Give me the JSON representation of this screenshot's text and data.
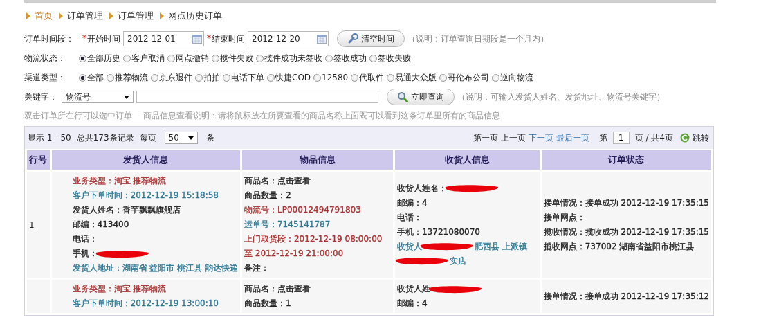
{
  "breadcrumb": [
    {
      "text": "首页",
      "home": true
    },
    {
      "text": "订单管理",
      "home": false
    },
    {
      "text": "订单管理",
      "home": false
    },
    {
      "text": "网点历史订单",
      "home": false
    }
  ],
  "time_range": {
    "label": "订单时间段：",
    "required_mark": "*",
    "start_label": "开始时间",
    "start_value": "2012-12-01",
    "end_label": "结束时间",
    "end_value": "2012-12-20",
    "clear_button": "清空时间",
    "note": "（说明：订单查询日期段是一个月内）"
  },
  "status_filter": {
    "label": "物流状态：",
    "options": [
      {
        "text": "全部历史",
        "selected": true
      },
      {
        "text": "客户取消",
        "selected": false
      },
      {
        "text": "网点撤销",
        "selected": false
      },
      {
        "text": "揽件失败",
        "selected": false
      },
      {
        "text": "揽件成功未签收",
        "selected": false
      },
      {
        "text": "签收成功",
        "selected": false
      },
      {
        "text": "签收失败",
        "selected": false
      }
    ]
  },
  "channel_filter": {
    "label": "渠道类型：",
    "options": [
      {
        "text": "全部",
        "selected": true
      },
      {
        "text": "推荐物流",
        "selected": false
      },
      {
        "text": "京东退件",
        "selected": false
      },
      {
        "text": "拍拍",
        "selected": false
      },
      {
        "text": "电话下单",
        "selected": false
      },
      {
        "text": "快捷COD",
        "selected": false
      },
      {
        "text": "12580",
        "selected": false
      },
      {
        "text": "代取件",
        "selected": false
      },
      {
        "text": "易通大众版",
        "selected": false
      },
      {
        "text": "哥伦布公司",
        "selected": false
      },
      {
        "text": "逆向物流",
        "selected": false
      }
    ]
  },
  "keyword": {
    "label": "关键字：",
    "field_select": "物流号",
    "search_button": "立即查询",
    "note": "（说明：可输入发货人姓名、发货地址、物流号关键字）"
  },
  "hints": [
    "双击订单所在行可以选中订单",
    "商品信息查看说明：请将鼠标放在所要查看的商品名称上面既可以看到这条订单里所有的商品信息"
  ],
  "pager": {
    "range": "显示 1 - 50",
    "total": "总共173条记录",
    "per_page_label": "每页",
    "per_page": "50",
    "per_page_unit": "条",
    "links": [
      {
        "text": "第一页",
        "enabled": false
      },
      {
        "text": "上一页",
        "enabled": false
      },
      {
        "text": "下一页",
        "enabled": true
      },
      {
        "text": "最后一页",
        "enabled": true
      }
    ],
    "page_label": "第",
    "page": "1",
    "page_total": "页 / 共4页",
    "jump_button": "跳转"
  },
  "table": {
    "columns": [
      "行号",
      "发货人信息",
      "物品信息",
      "收货人信息",
      "订单状态"
    ],
    "rows": [
      {
        "number": "1",
        "sender": [
          {
            "text": "业务类型：淘宝 推荐物流",
            "color": "#a83232"
          },
          {
            "text": "客户下单时间：2012-12-19 15:18:58",
            "color": "#2f7893"
          },
          {
            "text": "发货人姓名：香芋飘飘旗舰店",
            "color": "#222222"
          },
          {
            "text": "邮编：413400",
            "color": "#222222"
          },
          {
            "text": "电话：",
            "color": "#222222"
          },
          {
            "text": "手机：",
            "color": "#222222",
            "redacted": true
          },
          {
            "text": "发货人地址：湖南省 益阳市 桃江县 韵达快递",
            "color": "#2f7893"
          }
        ],
        "goods": [
          {
            "text": "商品名：点击查看",
            "color": "#222222"
          },
          {
            "text": "商品数量：2",
            "color": "#222222"
          },
          {
            "text": "物流号：LP00012494791803",
            "color": "#a83232"
          },
          {
            "text": "运单号：7145141787",
            "color": "#2f7893"
          },
          {
            "text": "上门取货段：2012-12-19 08:00:00 至 2012-12-19 21:00:00",
            "color": "#a83232"
          },
          {
            "text": "备注：",
            "color": "#222222"
          }
        ],
        "receiver": [
          {
            "text": "收货人姓名：",
            "color": "#222222",
            "redacted": true
          },
          {
            "text": "邮编：4",
            "color": "#222222"
          },
          {
            "text": "电话：",
            "color": "#222222"
          },
          {
            "text": "手机：13721080070",
            "color": "#222222"
          },
          {
            "text": "收货人",
            "color": "#2f7893",
            "redacted": true,
            "after": "肥西县 上派镇"
          },
          {
            "color": "#2f7893",
            "redacted": true,
            "after": "实店"
          }
        ],
        "status": [
          {
            "text": "接单情况：接单成功 2012-12-19 17:35:15",
            "color": "#222222"
          },
          {
            "text": "接单网点：",
            "color": "#222222"
          },
          {
            "text": "揽收情况：揽收成功 2012-12-19 17:35:15",
            "color": "#222222"
          },
          {
            "text": "揽收网点：737002 湖南省益阳市桃江县",
            "color": "#222222"
          }
        ]
      },
      {
        "number": "",
        "sender": [
          {
            "text": "业务类型：淘宝 推荐物流",
            "color": "#a83232"
          },
          {
            "text": "客户下单时间：2012-12-19 13:00:10",
            "color": "#2f7893"
          }
        ],
        "goods": [
          {
            "text": "商品名：点击查看",
            "color": "#222222"
          },
          {
            "text": "商品数量：1",
            "color": "#222222"
          }
        ],
        "receiver": [
          {
            "text": "收货人姓",
            "color": "#222222",
            "redacted": true
          },
          {
            "text": "邮编：4",
            "color": "#222222"
          }
        ],
        "status": [
          {
            "text": "接单情况：接单成功 2012-12-19 17:35:12",
            "color": "#222222"
          }
        ]
      }
    ]
  }
}
